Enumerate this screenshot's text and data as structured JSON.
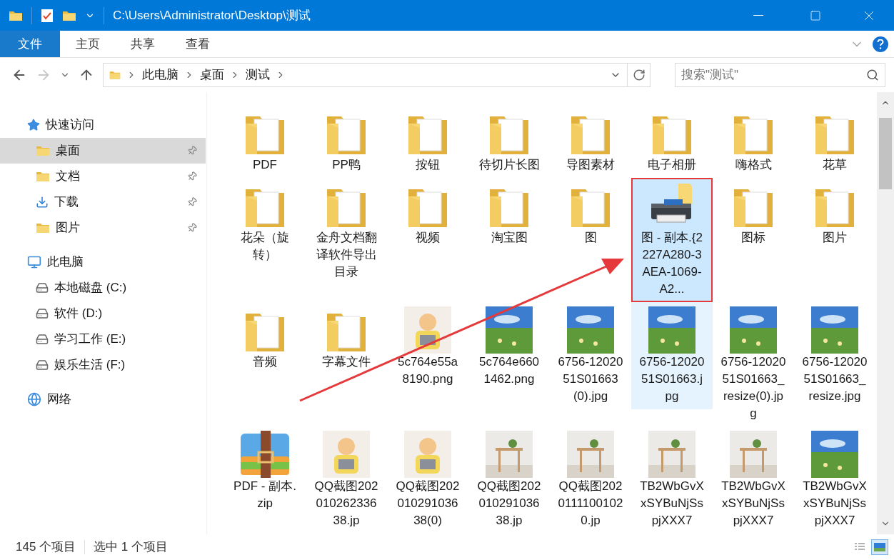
{
  "window": {
    "title": "C:\\Users\\Administrator\\Desktop\\测试"
  },
  "ribbon_tabs": [
    {
      "label": "文件",
      "selected": true
    },
    {
      "label": "主页",
      "selected": false
    },
    {
      "label": "共享",
      "selected": false
    },
    {
      "label": "查看",
      "selected": false
    }
  ],
  "navigation": {
    "forward_disabled": true
  },
  "breadcrumb": [
    "此电脑",
    "桌面",
    "测试"
  ],
  "search": {
    "placeholder": "搜索\"测试\""
  },
  "sidebar": [
    {
      "label": "快速访问",
      "kind": "star",
      "children": [
        {
          "label": "桌面",
          "kind": "desktop",
          "pinned": true,
          "selected": true
        },
        {
          "label": "文档",
          "kind": "documents",
          "pinned": true,
          "selected": false
        },
        {
          "label": "下载",
          "kind": "downloads",
          "pinned": true,
          "selected": false
        },
        {
          "label": "图片",
          "kind": "pictures",
          "pinned": true,
          "selected": false
        }
      ]
    },
    {
      "label": "此电脑",
      "kind": "pc",
      "children": [
        {
          "label": "本地磁盘 (C:)",
          "kind": "system-drive",
          "pinned": false,
          "selected": false
        },
        {
          "label": "软件 (D:)",
          "kind": "drive",
          "pinned": false,
          "selected": false
        },
        {
          "label": "学习工作 (E:)",
          "kind": "drive",
          "pinned": false,
          "selected": false
        },
        {
          "label": "娱乐生活 (F:)",
          "kind": "drive",
          "pinned": false,
          "selected": false
        }
      ]
    },
    {
      "label": "网络",
      "kind": "network"
    }
  ],
  "items": [
    {
      "name": "PDF",
      "kind": "folder",
      "selected": false,
      "hovered": false,
      "boxed": false
    },
    {
      "name": "PP鸭",
      "kind": "folder",
      "selected": false,
      "hovered": false,
      "boxed": false
    },
    {
      "name": "按钮",
      "kind": "folder",
      "selected": false,
      "hovered": false,
      "boxed": false
    },
    {
      "name": "待切片长图",
      "kind": "folder",
      "selected": false,
      "hovered": false,
      "boxed": false
    },
    {
      "name": "导图素材",
      "kind": "folder",
      "selected": false,
      "hovered": false,
      "boxed": false
    },
    {
      "name": "电子相册",
      "kind": "folder",
      "selected": false,
      "hovered": false,
      "boxed": false
    },
    {
      "name": "嗨格式",
      "kind": "folder",
      "selected": false,
      "hovered": false,
      "boxed": false
    },
    {
      "name": "花草",
      "kind": "folder",
      "selected": false,
      "hovered": false,
      "boxed": false
    },
    {
      "name": "花朵（旋转）",
      "kind": "folder",
      "selected": false,
      "hovered": false,
      "boxed": false
    },
    {
      "name": "金舟文档翻译软件导出目录",
      "kind": "folder",
      "selected": false,
      "hovered": false,
      "boxed": false
    },
    {
      "name": "视频",
      "kind": "folder",
      "selected": false,
      "hovered": false,
      "boxed": false
    },
    {
      "name": "淘宝图",
      "kind": "folder",
      "selected": false,
      "hovered": false,
      "boxed": false
    },
    {
      "name": "图",
      "kind": "folder",
      "selected": false,
      "hovered": false,
      "boxed": false
    },
    {
      "name": "图 - 副本.{2227A280-3AEA-1069-A2...",
      "kind": "printer",
      "selected": true,
      "hovered": false,
      "boxed": true
    },
    {
      "name": "图标",
      "kind": "folder",
      "selected": false,
      "hovered": false,
      "boxed": false
    },
    {
      "name": "图片",
      "kind": "folder",
      "selected": false,
      "hovered": false,
      "boxed": false
    },
    {
      "name": "音频",
      "kind": "folder",
      "selected": false,
      "hovered": false,
      "boxed": false
    },
    {
      "name": "字幕文件",
      "kind": "folder",
      "selected": false,
      "hovered": false,
      "boxed": false
    },
    {
      "name": "5c764e55a8190.png",
      "selected": false,
      "hovered": false,
      "boxed": false
    },
    {
      "name": "5c764e6601462.png",
      "selected": false,
      "hovered": false,
      "boxed": false
    },
    {
      "name": "6756-1202051S01663(0).jpg",
      "selected": false,
      "hovered": false,
      "boxed": false
    },
    {
      "name": "6756-1202051S01663.jpg",
      "selected": false,
      "hovered": true,
      "boxed": false
    },
    {
      "name": "6756-1202051S01663_resize(0).jpg",
      "selected": false,
      "hovered": false,
      "boxed": false
    },
    {
      "name": "6756-1202051S01663_resize.jpg",
      "selected": false,
      "hovered": false,
      "boxed": false
    },
    {
      "name": "PDF - 副本.zip",
      "kind": "zip",
      "selected": false,
      "hovered": false,
      "boxed": false
    },
    {
      "name": "QQ截图20201026233638.jp",
      "selected": false,
      "hovered": false,
      "boxed": false
    },
    {
      "name": "QQ截图20201029103638(0)",
      "selected": false,
      "hovered": false,
      "boxed": false
    },
    {
      "name": "QQ截图20201029103638.jp",
      "selected": false,
      "hovered": false,
      "boxed": false
    },
    {
      "name": "QQ截图20201111001020.jp",
      "selected": false,
      "hovered": false,
      "boxed": false
    },
    {
      "name": "TB2WbGvXxSYBuNjSspjXXX7",
      "selected": false,
      "hovered": false,
      "boxed": false
    },
    {
      "name": "TB2WbGvXxSYBuNjSspjXXX7",
      "selected": false,
      "hovered": false,
      "boxed": false
    },
    {
      "name": "TB2WbGvXxSYBuNjSspjXXX7",
      "selected": false,
      "hovered": false,
      "boxed": false
    }
  ],
  "status_bar": {
    "count": "145 个项目",
    "selection": "选中 1 个项目"
  },
  "view_buttons": [
    {
      "kind": "details",
      "selected": false
    },
    {
      "kind": "large-icons",
      "selected": true
    }
  ]
}
